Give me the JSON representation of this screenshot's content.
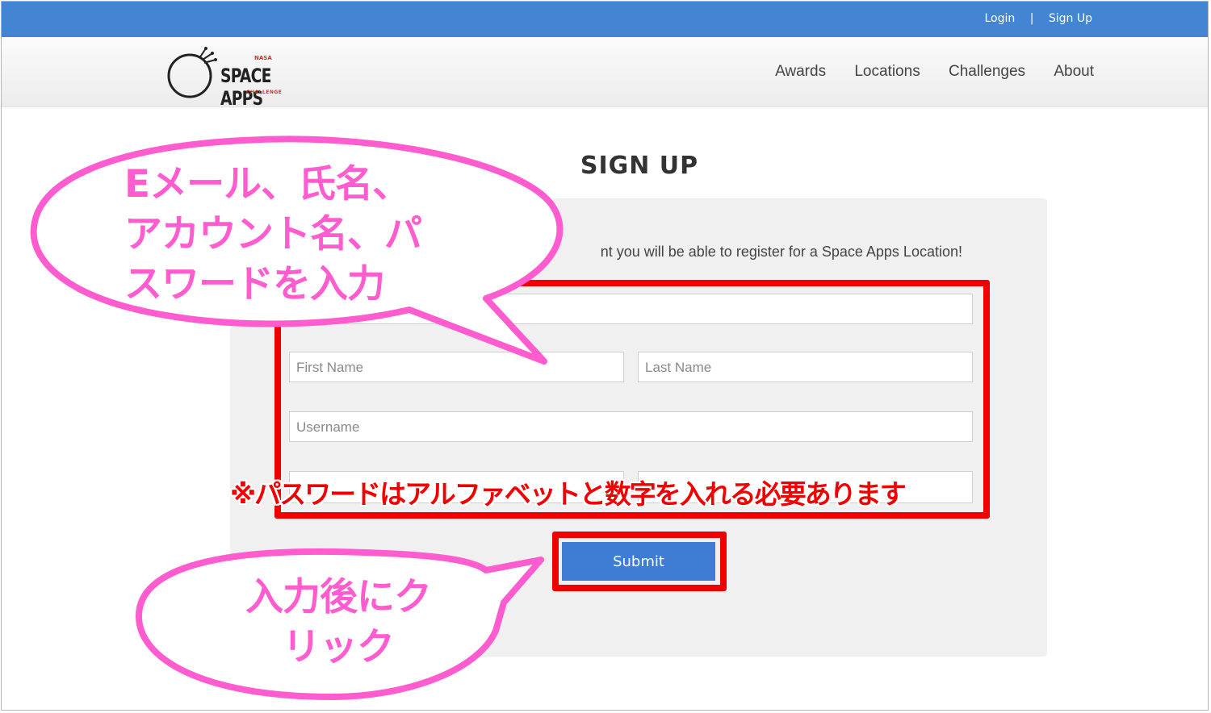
{
  "topbar": {
    "login": "Login",
    "separator": "|",
    "signup": "Sign Up"
  },
  "logo": {
    "brand": "SPACE APPS",
    "nasa": "NASA",
    "sub": "CHALLENGE"
  },
  "nav": {
    "awards": "Awards",
    "locations": "Locations",
    "challenges": "Challenges",
    "about": "About"
  },
  "page": {
    "title": "SIGN UP",
    "intro": "nt you will be able to register for a Space Apps Location!"
  },
  "form": {
    "first_name_placeholder": "First Name",
    "last_name_placeholder": "Last Name",
    "username_placeholder": "Username",
    "submit_label": "Submit"
  },
  "annotations": {
    "bubble1_line1": "Eメール、氏名、",
    "bubble1_line2": "アカウント名、パ",
    "bubble1_line3": "スワードを入力",
    "note": "※パスワードはアルファベットと数字を入れる必要あります",
    "bubble2_line1": "入力後にク",
    "bubble2_line2": "リック"
  },
  "colors": {
    "topbar": "#4485d3",
    "accent_red": "#f00000",
    "bubble_pink": "#ff5ccf",
    "submit": "#3d7ed4"
  }
}
